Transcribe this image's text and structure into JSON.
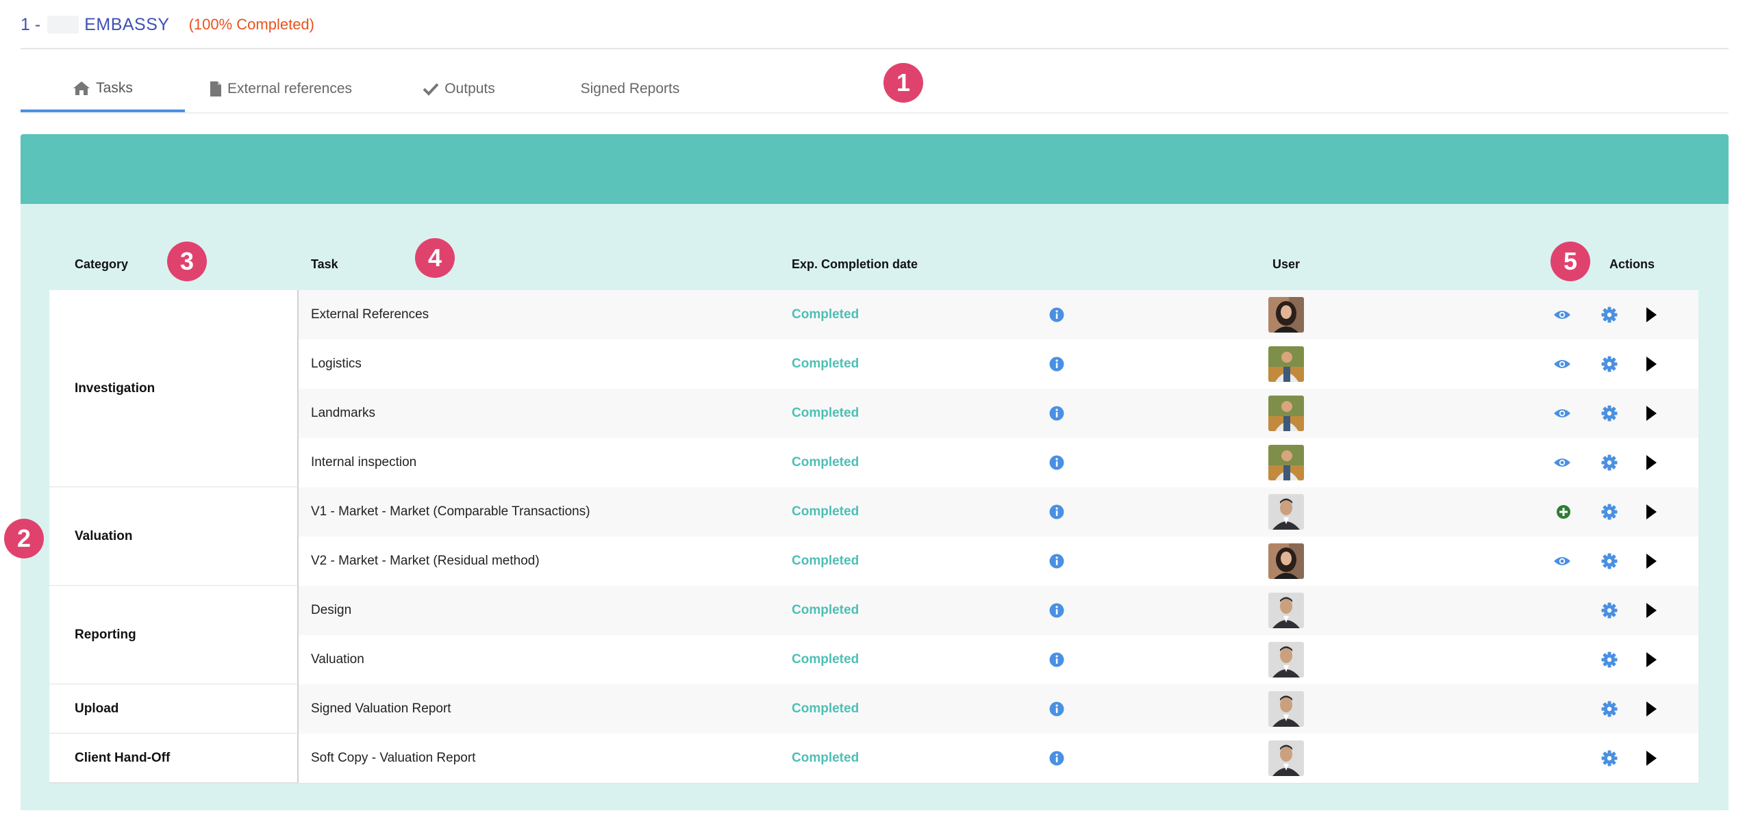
{
  "header": {
    "prefix": "1 -",
    "name": "EMBASSY",
    "progress": "(100% Completed)"
  },
  "tabs": [
    {
      "label": "Tasks",
      "icon": "home-icon",
      "active": true
    },
    {
      "label": "External references",
      "icon": "file-icon",
      "active": false
    },
    {
      "label": "Outputs",
      "icon": "check-icon",
      "active": false
    },
    {
      "label": "Signed Reports",
      "icon": "",
      "active": false
    }
  ],
  "markers": [
    "1",
    "2",
    "3",
    "4",
    "5"
  ],
  "table": {
    "headers": {
      "category": "Category",
      "task": "Task",
      "date": "Exp. Completion date",
      "user": "User",
      "actions": "Actions"
    },
    "categories": [
      {
        "label": "Investigation",
        "rows": 4
      },
      {
        "label": "Valuation",
        "rows": 2
      },
      {
        "label": "Reporting",
        "rows": 2
      },
      {
        "label": "Upload",
        "rows": 1
      },
      {
        "label": "Client Hand-Off",
        "rows": 1
      }
    ],
    "rows": [
      {
        "task": "External References",
        "status": "Completed",
        "user_avatar": "woman-avatar",
        "view_action": "eye-icon"
      },
      {
        "task": "Logistics",
        "status": "Completed",
        "user_avatar": "man-outdoor-avatar",
        "view_action": "eye-icon"
      },
      {
        "task": "Landmarks",
        "status": "Completed",
        "user_avatar": "man-outdoor-avatar",
        "view_action": "eye-icon"
      },
      {
        "task": "Internal inspection",
        "status": "Completed",
        "user_avatar": "man-outdoor-avatar",
        "view_action": "eye-icon"
      },
      {
        "task": "V1 - Market - Market (Comparable Transactions)",
        "status": "Completed",
        "user_avatar": "man-suit-avatar",
        "view_action": "plus-circle-icon"
      },
      {
        "task": "V2 - Market - Market (Residual method)",
        "status": "Completed",
        "user_avatar": "woman-avatar",
        "view_action": "eye-icon"
      },
      {
        "task": "Design",
        "status": "Completed",
        "user_avatar": "man-suit-avatar",
        "view_action": ""
      },
      {
        "task": "Valuation",
        "status": "Completed",
        "user_avatar": "man-suit-avatar",
        "view_action": ""
      },
      {
        "task": "Signed Valuation Report",
        "status": "Completed",
        "user_avatar": "man-suit-avatar",
        "view_action": ""
      },
      {
        "task": "Soft Copy - Valuation Report",
        "status": "Completed",
        "user_avatar": "man-suit-avatar",
        "view_action": ""
      }
    ]
  },
  "colors": {
    "accent": "#3f51b5",
    "progress": "#e8531c",
    "status_completed": "#4dbfb5",
    "panel_header": "#5cc3ba",
    "panel_body": "#d9f2f0",
    "marker": "#e0426e",
    "icon_blue": "#4a90e2",
    "plus_green": "#2e7d32"
  }
}
